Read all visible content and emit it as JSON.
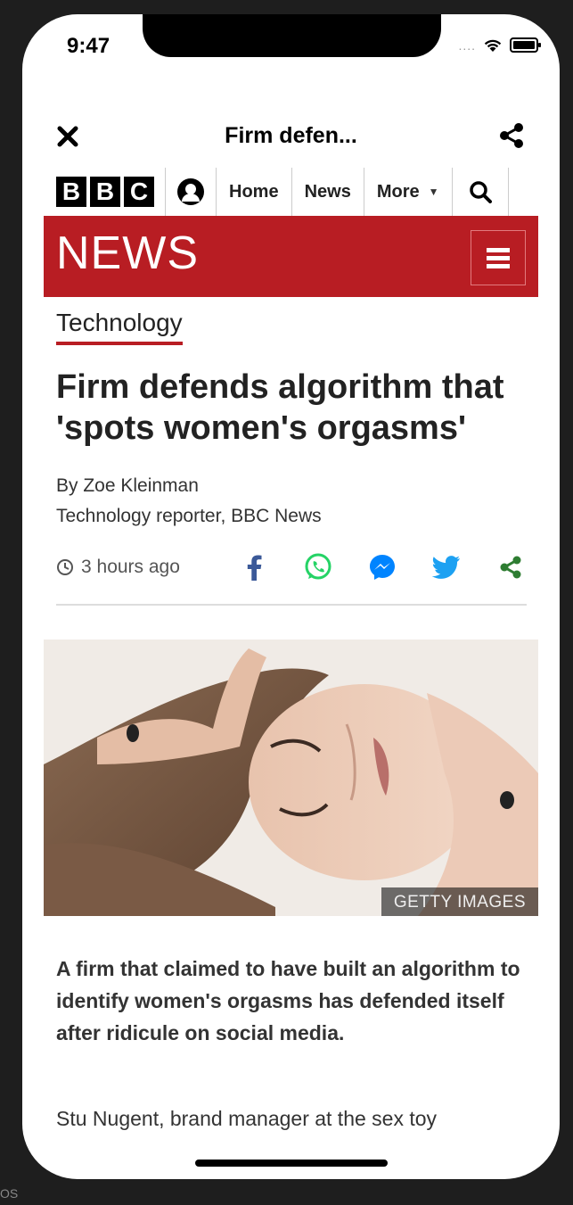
{
  "status_bar": {
    "time": "9:47",
    "signal": "...."
  },
  "top_bar": {
    "title": "Firm defen..."
  },
  "bbc_nav": {
    "logo_letters": [
      "B",
      "B",
      "C"
    ],
    "items": [
      "Home",
      "News",
      "More"
    ]
  },
  "news_bar": {
    "logo": "NEWS"
  },
  "article": {
    "section": "Technology",
    "headline": "Firm defends algorithm that 'spots women's orgasms'",
    "author": "By Zoe Kleinman",
    "author_role": "Technology reporter, BBC News",
    "timestamp": "3 hours ago",
    "image_credit": "GETTY IMAGES",
    "intro": "A firm that claimed to have built an algorithm to identify women's orgasms has defended itself after ridicule on social media.",
    "paragraph": "Stu Nugent, brand manager at the sex toy"
  },
  "background": {
    "label": "OS"
  },
  "colors": {
    "bbc_red": "#b81d23",
    "facebook": "#3b5998",
    "whatsapp": "#25d366",
    "messenger": "#0084ff",
    "twitter": "#1da1f2",
    "share": "#2e7d32"
  }
}
